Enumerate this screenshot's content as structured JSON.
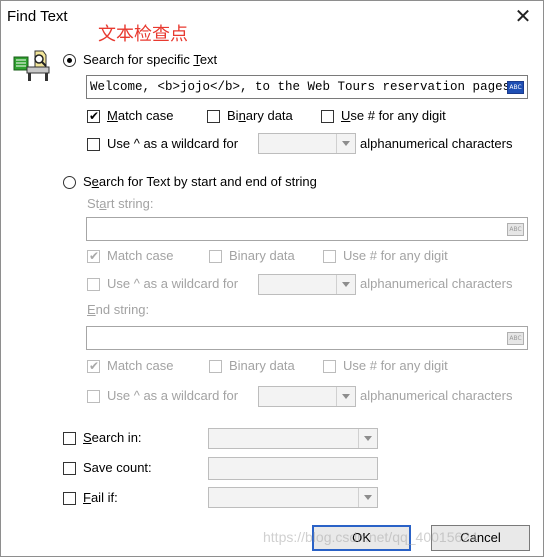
{
  "window": {
    "title": "Find Text",
    "watermark": "文本检查点",
    "close_glyph": "✕"
  },
  "specific": {
    "radio_label_pre": "Search for specific ",
    "radio_label_u": "T",
    "radio_label_post": "ext",
    "value": "Welcome, <b>jojo</b>, to the Web Tours reservation pages",
    "match_case_u": "M",
    "match_case_rest": "atch case",
    "binary_pre": "Bi",
    "binary_u": "n",
    "binary_post": "ary data",
    "digit_u": "U",
    "digit_rest": "se # for any digit",
    "wildcard_label": "Use ^ as a wildcard for",
    "alpha_label": "alphanumerical characters"
  },
  "startend": {
    "radio_label_pre": "S",
    "radio_label_u": "e",
    "radio_label_post": "arch for Text by start and end of string",
    "start_label_pre": "St",
    "start_label_u": "a",
    "start_label_post": "rt string:",
    "end_label_u": "E",
    "end_label_rest": "nd string:",
    "match_case": "Match case",
    "binary": "Binary data",
    "digit": "Use # for any digit",
    "wildcard_label": "Use ^ as a wildcard for",
    "alpha_label": "alphanumerical characters"
  },
  "options": {
    "search_in_u": "S",
    "search_in_rest": "earch in:",
    "save_count": "Save count:",
    "fail_if_u": "F",
    "fail_if_rest": "ail if:"
  },
  "buttons": {
    "ok": "OK",
    "cancel": "Cancel"
  },
  "bottom_watermark": "https://blog.csdn.net/qq_40015624"
}
